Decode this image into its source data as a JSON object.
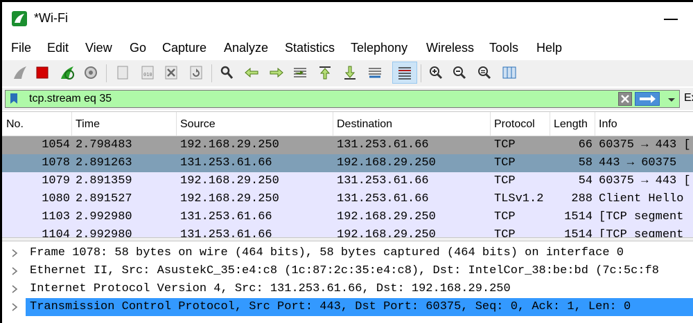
{
  "window": {
    "title": "*Wi-Fi"
  },
  "menu": [
    "File",
    "Edit",
    "View",
    "Go",
    "Capture",
    "Analyze",
    "Statistics",
    "Telephony",
    "Wireless",
    "Tools",
    "Help"
  ],
  "toolbar": {
    "icons": [
      "shark-fin-icon",
      "stop-capture-icon",
      "restart-capture-icon",
      "capture-options-icon",
      "open-file-icon",
      "save-file-icon",
      "close-file-icon",
      "reload-icon",
      "find-packet-icon",
      "go-back-icon",
      "go-forward-icon",
      "go-to-packet-icon",
      "first-packet-icon",
      "last-packet-icon",
      "auto-scroll-icon",
      "colorize-icon",
      "zoom-in-icon",
      "zoom-out-icon",
      "normal-size-icon",
      "resize-columns-icon"
    ]
  },
  "filter": {
    "value": "tcp.stream eq 35",
    "expression_label": "Ex",
    "colors": {
      "valid_bg": "#aff9a8"
    }
  },
  "packet_list": {
    "columns": [
      "No.",
      "Time",
      "Source",
      "Destination",
      "Protocol",
      "Length",
      "Info"
    ],
    "rows": [
      {
        "no": "1054",
        "time": "2.798483",
        "source": "192.168.29.250",
        "destination": "131.253.61.66",
        "protocol": "TCP",
        "length": "66",
        "info": "60375 → 443 [",
        "bg": "#a0a0a0"
      },
      {
        "no": "1078",
        "time": "2.891263",
        "source": "131.253.61.66",
        "destination": "192.168.29.250",
        "protocol": "TCP",
        "length": "58",
        "info": "443 → 60375 ",
        "bg": "#7f9fb7"
      },
      {
        "no": "1079",
        "time": "2.891359",
        "source": "192.168.29.250",
        "destination": "131.253.61.66",
        "protocol": "TCP",
        "length": "54",
        "info": "60375 → 443 [",
        "bg": "#e7e6ff"
      },
      {
        "no": "1080",
        "time": "2.891527",
        "source": "192.168.29.250",
        "destination": "131.253.61.66",
        "protocol": "TLSv1.2",
        "length": "288",
        "info": "Client Hello",
        "bg": "#e7e6ff"
      },
      {
        "no": "1103",
        "time": "2.992980",
        "source": "131.253.61.66",
        "destination": "192.168.29.250",
        "protocol": "TCP",
        "length": "1514",
        "info": "[TCP segment",
        "bg": "#e7e6ff"
      },
      {
        "no": "1104",
        "time": "2.992980",
        "source": "131.253.61.66",
        "destination": "192.168.29.250",
        "protocol": "TCP",
        "length": "1514",
        "info": "[TCP segment",
        "bg": "#e7e6ff"
      }
    ]
  },
  "details": {
    "rows": [
      {
        "text": "Frame 1078: 58 bytes on wire (464 bits), 58 bytes captured (464 bits) on interface 0",
        "selected": false
      },
      {
        "text": "Ethernet II, Src: AsustekC_35:e4:c8 (1c:87:2c:35:e4:c8), Dst: IntelCor_38:be:bd (7c:5c:f8",
        "selected": false
      },
      {
        "text": "Internet Protocol Version 4, Src: 131.253.61.66, Dst: 192.168.29.250",
        "selected": false
      },
      {
        "text": "Transmission Control Protocol, Src Port: 443, Dst Port: 60375, Seq: 0, Ack: 1, Len: 0",
        "selected": true
      }
    ]
  }
}
